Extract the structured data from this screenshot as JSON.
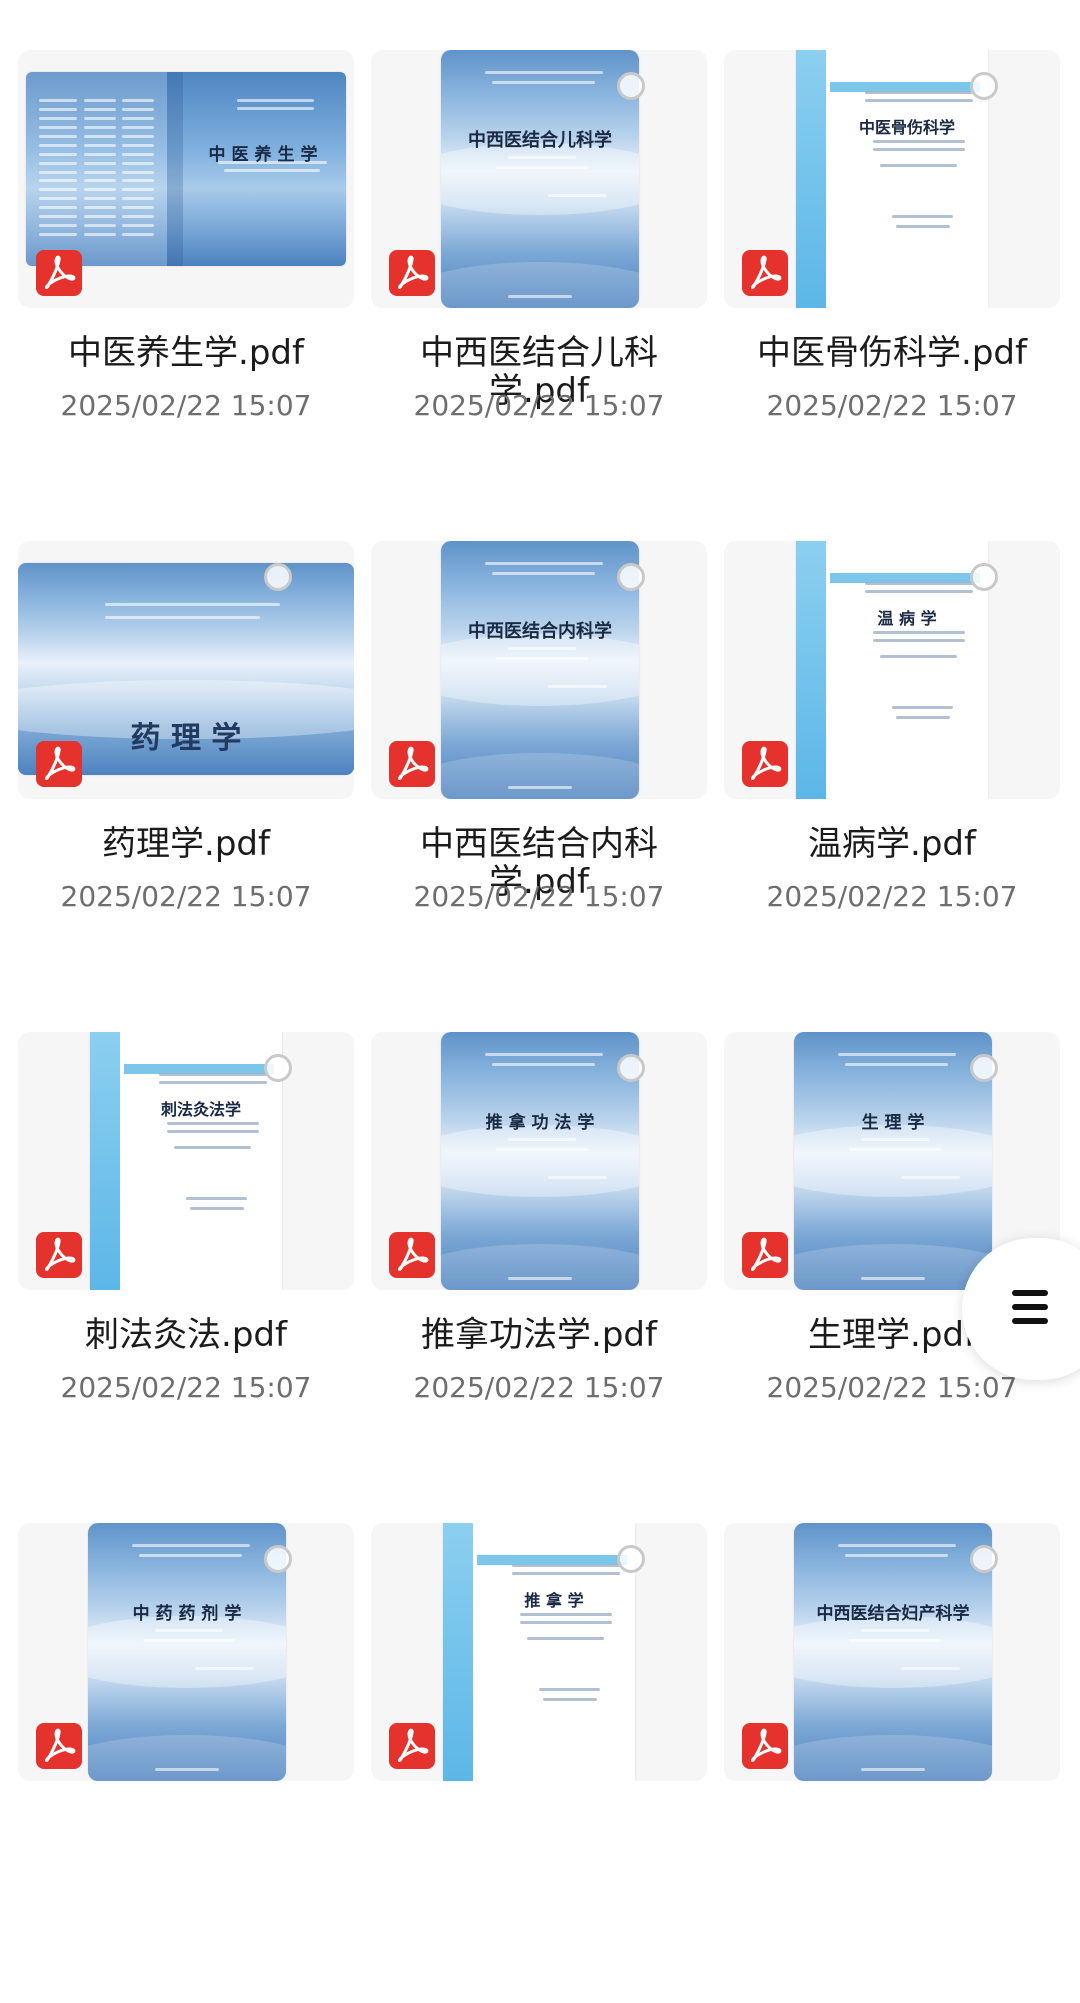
{
  "files": [
    {
      "name": "中医养生学.pdf",
      "date": "2025/02/22 15:07",
      "cover_title": "中医养生学",
      "cover_style": "spread"
    },
    {
      "name": "中西医结合儿科学.pdf",
      "date": "2025/02/22 15:07",
      "cover_title": "中西医结合儿科学",
      "cover_style": "blue"
    },
    {
      "name": "中医骨伤科学.pdf",
      "date": "2025/02/22 15:07",
      "cover_title": "中医骨伤科学",
      "cover_style": "white"
    },
    {
      "name": "药理学.pdf",
      "date": "2025/02/22 15:07",
      "cover_title": "药    理    学",
      "cover_style": "landscape"
    },
    {
      "name": "中西医结合内科学.pdf",
      "date": "2025/02/22 15:07",
      "cover_title": "中西医结合内科学",
      "cover_style": "blue"
    },
    {
      "name": "温病学.pdf",
      "date": "2025/02/22 15:07",
      "cover_title": "温 病 学",
      "cover_style": "white"
    },
    {
      "name": "刺法灸法.pdf",
      "date": "2025/02/22 15:07",
      "cover_title": "刺法灸法学",
      "cover_style": "white"
    },
    {
      "name": "推拿功法学.pdf",
      "date": "2025/02/22 15:07",
      "cover_title": "推 拿 功 法 学",
      "cover_style": "blue"
    },
    {
      "name": "生理学.pdf",
      "date": "2025/02/22 15:07",
      "cover_title": "生   理   学",
      "cover_style": "blue"
    },
    {
      "name": "",
      "date": "",
      "cover_title": "中 药 药 剂 学",
      "cover_style": "blue"
    },
    {
      "name": "",
      "date": "",
      "cover_title": "推   拿   学",
      "cover_style": "white"
    },
    {
      "name": "",
      "date": "",
      "cover_title": "中西医结合妇产科学",
      "cover_style": "blue"
    }
  ],
  "colors": {
    "pdf_badge": "#e5322d",
    "date_text": "#6e6e6e",
    "name_text": "#1b1b1b"
  },
  "icons": {
    "file_badge": "pdf-icon",
    "select": "select-circle-icon",
    "fab": "menu-icon"
  }
}
